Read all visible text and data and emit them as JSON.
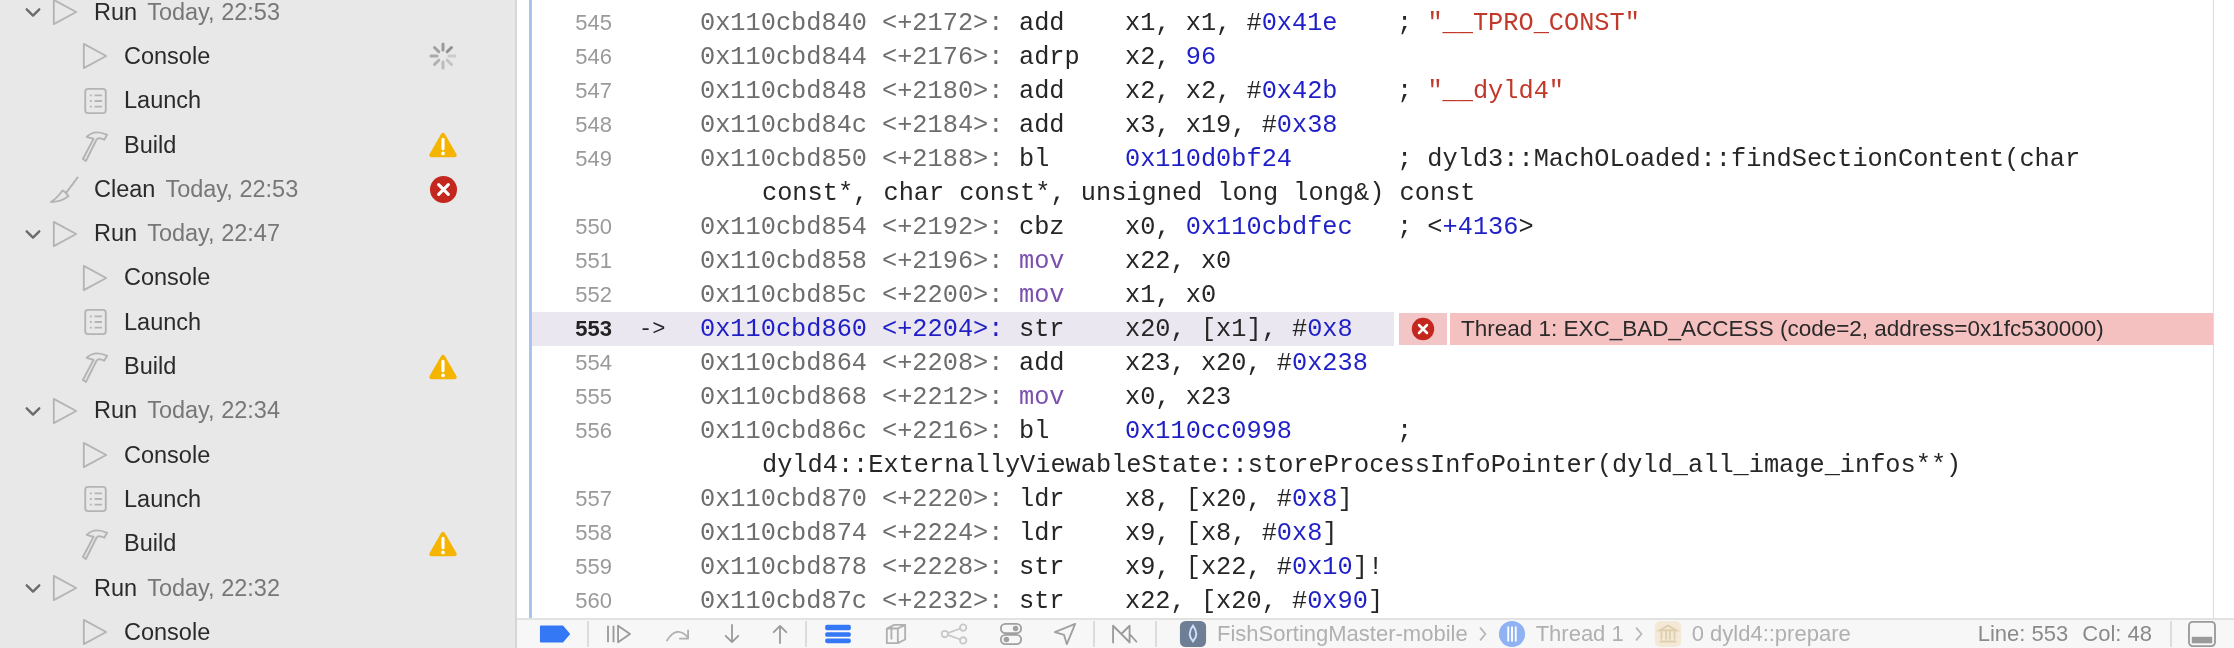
{
  "sidebar": {
    "items": [
      {
        "kind": "run",
        "label": "Run",
        "time": "Today, 22:53",
        "expanded": true,
        "children": [
          {
            "kind": "console",
            "label": "Console",
            "status": {
              "kind": "spinner"
            }
          },
          {
            "kind": "launch",
            "label": "Launch"
          },
          {
            "kind": "build",
            "label": "Build",
            "status": {
              "kind": "warning"
            }
          }
        ]
      },
      {
        "kind": "clean",
        "label": "Clean",
        "time": "Today, 22:53",
        "status": {
          "kind": "error"
        }
      },
      {
        "kind": "run",
        "label": "Run",
        "time": "Today, 22:47",
        "expanded": true,
        "children": [
          {
            "kind": "console",
            "label": "Console"
          },
          {
            "kind": "launch",
            "label": "Launch"
          },
          {
            "kind": "build",
            "label": "Build",
            "status": {
              "kind": "warning"
            }
          }
        ]
      },
      {
        "kind": "run",
        "label": "Run",
        "time": "Today, 22:34",
        "expanded": true,
        "children": [
          {
            "kind": "console",
            "label": "Console"
          },
          {
            "kind": "launch",
            "label": "Launch"
          },
          {
            "kind": "build",
            "label": "Build",
            "status": {
              "kind": "warning"
            }
          }
        ]
      },
      {
        "kind": "run",
        "label": "Run",
        "time": "Today, 22:32",
        "expanded": true,
        "children": [
          {
            "kind": "console",
            "label": "Console"
          }
        ]
      }
    ]
  },
  "disassembly": {
    "rows": [
      {
        "number": "545",
        "current": false,
        "address": "0x110cbd840",
        "offset": "<+2172>:",
        "opcode": {
          "text": "add",
          "kind": "plain"
        },
        "operands": [
          {
            "text": "x1, x1, #",
            "kind": "plain"
          },
          {
            "text": "0x41e",
            "kind": "number"
          }
        ],
        "comment": [
          {
            "text": "; ",
            "kind": "plain"
          },
          {
            "text": "\"__TPRO_CONST\"",
            "kind": "string"
          }
        ]
      },
      {
        "number": "546",
        "current": false,
        "address": "0x110cbd844",
        "offset": "<+2176>:",
        "opcode": {
          "text": "adrp",
          "kind": "plain"
        },
        "operands": [
          {
            "text": "x2, ",
            "kind": "plain"
          },
          {
            "text": "96",
            "kind": "number"
          }
        ]
      },
      {
        "number": "547",
        "current": false,
        "address": "0x110cbd848",
        "offset": "<+2180>:",
        "opcode": {
          "text": "add",
          "kind": "plain"
        },
        "operands": [
          {
            "text": "x2, x2, #",
            "kind": "plain"
          },
          {
            "text": "0x42b",
            "kind": "number"
          }
        ],
        "comment": [
          {
            "text": "; ",
            "kind": "plain"
          },
          {
            "text": "\"__dyld4\"",
            "kind": "string"
          }
        ]
      },
      {
        "number": "548",
        "current": false,
        "address": "0x110cbd84c",
        "offset": "<+2184>:",
        "opcode": {
          "text": "add",
          "kind": "plain"
        },
        "operands": [
          {
            "text": "x3, x19, #",
            "kind": "plain"
          },
          {
            "text": "0x38",
            "kind": "number"
          }
        ]
      },
      {
        "number": "549",
        "current": false,
        "address": "0x110cbd850",
        "offset": "<+2188>:",
        "opcode": {
          "text": "bl",
          "kind": "plain"
        },
        "operands": [
          {
            "text": "0x110d0bf24",
            "kind": "number"
          }
        ],
        "comment": [
          {
            "text": "; dyld3::MachOLoaded::findSectionContent(char",
            "kind": "plain"
          }
        ],
        "comment_wrap": "const*, char const*, unsigned long long&) const"
      },
      {
        "number": "550",
        "current": false,
        "address": "0x110cbd854",
        "offset": "<+2192>:",
        "opcode": {
          "text": "cbz",
          "kind": "plain"
        },
        "operands": [
          {
            "text": "x0, ",
            "kind": "plain"
          },
          {
            "text": "0x110cbdfec",
            "kind": "number"
          }
        ],
        "comment": [
          {
            "text": "; <",
            "kind": "plain"
          },
          {
            "text": "+4136",
            "kind": "number"
          },
          {
            "text": ">",
            "kind": "plain"
          }
        ]
      },
      {
        "number": "551",
        "current": false,
        "address": "0x110cbd858",
        "offset": "<+2196>:",
        "opcode": {
          "text": "mov",
          "kind": "keyword"
        },
        "operands": [
          {
            "text": "x22, x0",
            "kind": "plain"
          }
        ]
      },
      {
        "number": "552",
        "current": false,
        "address": "0x110cbd85c",
        "offset": "<+2200>:",
        "opcode": {
          "text": "mov",
          "kind": "keyword"
        },
        "operands": [
          {
            "text": "x1, x0",
            "kind": "plain"
          }
        ]
      },
      {
        "number": "553",
        "current": true,
        "marker": "->",
        "address": "0x110cbd860",
        "offset": "<+2204>:",
        "opcode": {
          "text": "str",
          "kind": "plain"
        },
        "operands": [
          {
            "text": "x20, [x1], #",
            "kind": "plain"
          },
          {
            "text": "0x8",
            "kind": "number"
          }
        ],
        "annotation": {
          "kind": "error",
          "text": "Thread 1: EXC_BAD_ACCESS (code=2, address=0x1fc530000)"
        }
      },
      {
        "number": "554",
        "current": false,
        "address": "0x110cbd864",
        "offset": "<+2208>:",
        "opcode": {
          "text": "add",
          "kind": "plain"
        },
        "operands": [
          {
            "text": "x23, x20, #",
            "kind": "plain"
          },
          {
            "text": "0x238",
            "kind": "number"
          }
        ]
      },
      {
        "number": "555",
        "current": false,
        "address": "0x110cbd868",
        "offset": "<+2212>:",
        "opcode": {
          "text": "mov",
          "kind": "keyword"
        },
        "operands": [
          {
            "text": "x0, x23",
            "kind": "plain"
          }
        ]
      },
      {
        "number": "556",
        "current": false,
        "address": "0x110cbd86c",
        "offset": "<+2216>:",
        "opcode": {
          "text": "bl",
          "kind": "plain"
        },
        "operands": [
          {
            "text": "0x110cc0998",
            "kind": "number"
          }
        ],
        "comment": [
          {
            "text": ";",
            "kind": "plain"
          }
        ],
        "comment_wrap": "dyld4::ExternallyViewableState::storeProcessInfoPointer(dyld_all_image_infos**)"
      },
      {
        "number": "557",
        "current": false,
        "address": "0x110cbd870",
        "offset": "<+2220>:",
        "opcode": {
          "text": "ldr",
          "kind": "plain"
        },
        "operands": [
          {
            "text": "x8, [x20, #",
            "kind": "plain"
          },
          {
            "text": "0x8",
            "kind": "number"
          },
          {
            "text": "]",
            "kind": "plain"
          }
        ]
      },
      {
        "number": "558",
        "current": false,
        "address": "0x110cbd874",
        "offset": "<+2224>:",
        "opcode": {
          "text": "ldr",
          "kind": "plain"
        },
        "operands": [
          {
            "text": "x9, [x8, #",
            "kind": "plain"
          },
          {
            "text": "0x8",
            "kind": "number"
          },
          {
            "text": "]",
            "kind": "plain"
          }
        ]
      },
      {
        "number": "559",
        "current": false,
        "address": "0x110cbd878",
        "offset": "<+2228>:",
        "opcode": {
          "text": "str",
          "kind": "plain"
        },
        "operands": [
          {
            "text": "x9, [x22, #",
            "kind": "plain"
          },
          {
            "text": "0x10",
            "kind": "number"
          },
          {
            "text": "]!",
            "kind": "plain"
          }
        ]
      },
      {
        "number": "560",
        "current": false,
        "address": "0x110cbd87c",
        "offset": "<+2232>:",
        "opcode": {
          "text": "str",
          "kind": "plain"
        },
        "operands": [
          {
            "text": "x22, [x20, #",
            "kind": "plain"
          },
          {
            "text": "0x90",
            "kind": "number"
          },
          {
            "text": "]",
            "kind": "plain"
          }
        ]
      }
    ]
  },
  "debug_bar": {
    "button_groups": [
      [
        {
          "kind": "breakpoints",
          "on": true
        }
      ],
      [
        {
          "kind": "continue"
        },
        {
          "kind": "step-over"
        },
        {
          "kind": "step-into"
        },
        {
          "kind": "step-out"
        }
      ],
      [
        {
          "kind": "view-debugger",
          "on": true
        },
        {
          "kind": "memory"
        },
        {
          "kind": "graph"
        },
        {
          "kind": "environment"
        },
        {
          "kind": "location"
        }
      ],
      [
        {
          "kind": "frames"
        }
      ]
    ],
    "breadcrumbs": [
      {
        "kind": "app",
        "label": "FishSortingMaster-mobile"
      },
      {
        "kind": "thread",
        "label": "Thread 1"
      },
      {
        "kind": "frame",
        "label": "0 dyld4::prepare"
      }
    ],
    "line": "Line: 553",
    "column": "Col: 48"
  }
}
